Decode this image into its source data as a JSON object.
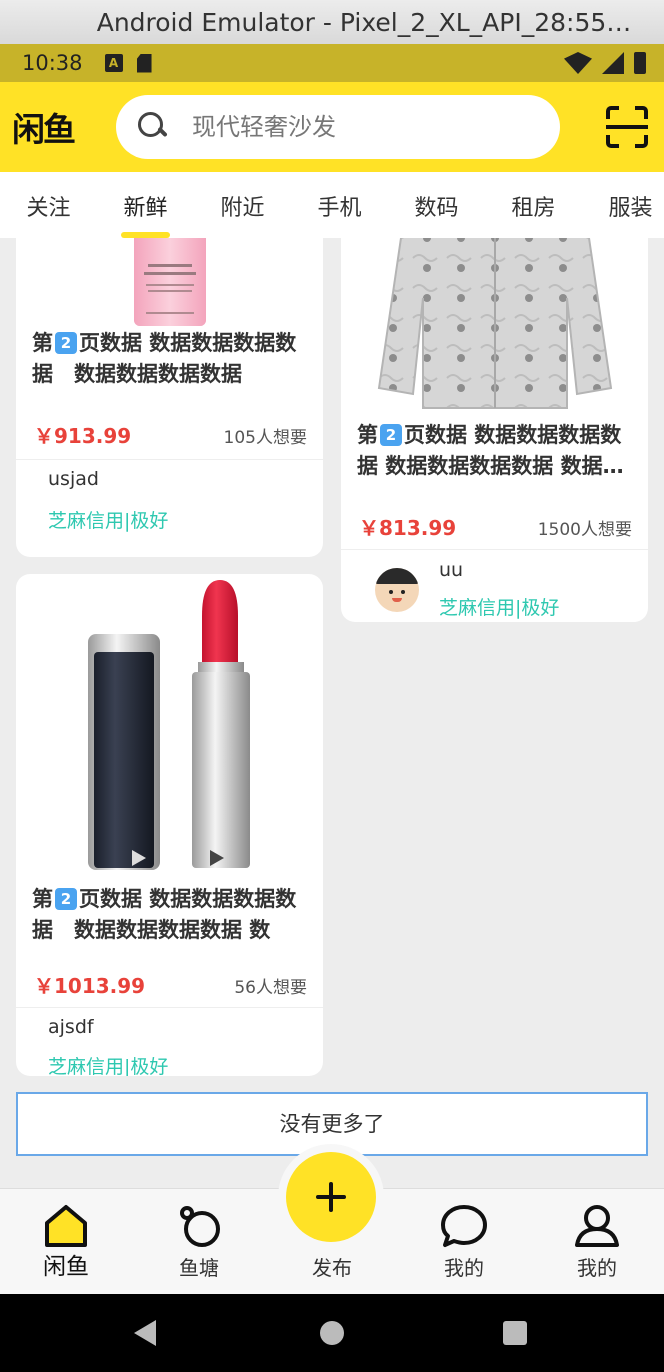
{
  "window": {
    "title": "Android Emulator - Pixel_2_XL_API_28:55…"
  },
  "status_bar": {
    "time": "10:38",
    "notif_badge": "A"
  },
  "header": {
    "logo": "闲鱼",
    "search_placeholder": "现代轻奢沙发"
  },
  "tabs": [
    {
      "label": "关注"
    },
    {
      "label": "新鲜",
      "active": true
    },
    {
      "label": "附近"
    },
    {
      "label": "手机"
    },
    {
      "label": "数码"
    },
    {
      "label": "租房"
    },
    {
      "label": "服装"
    }
  ],
  "products": [
    {
      "title_prefix": "第",
      "page_num": "2",
      "title_rest": "页数据 数据数据数据数据　数据数据数据数据",
      "price": "￥913.99",
      "want": "105人想要",
      "seller": "usjad",
      "credit": "芝麻信用|极好",
      "image": "toner-bottle"
    },
    {
      "title_prefix": "第",
      "page_num": "2",
      "title_rest": "页数据 数据数据数据数据 数据数据数据数据 数据…",
      "price": "￥813.99",
      "want": "1500人想要",
      "seller": "uu",
      "credit": "芝麻信用|极好",
      "image": "gray-jacket"
    },
    {
      "title_prefix": "第",
      "page_num": "2",
      "title_rest": "页数据 数据数据数据数据　数据数据数据数据 数据…",
      "price": "￥1013.99",
      "want": "56人想要",
      "seller": "ajsdf",
      "credit": "芝麻信用|极好",
      "image": "lipstick"
    }
  ],
  "footer_text": "没有更多了",
  "bottom_nav": [
    {
      "label": "闲鱼",
      "icon": "home-icon",
      "active": true
    },
    {
      "label": "鱼塘",
      "icon": "pond-icon"
    },
    {
      "label": "发布",
      "icon": "plus-icon"
    },
    {
      "label": "我的",
      "icon": "message-icon"
    },
    {
      "label": "我的",
      "icon": "user-icon"
    }
  ],
  "colors": {
    "brand_yellow": "#ffe226",
    "price_red": "#e8423a",
    "credit_teal": "#2ec8b0"
  }
}
